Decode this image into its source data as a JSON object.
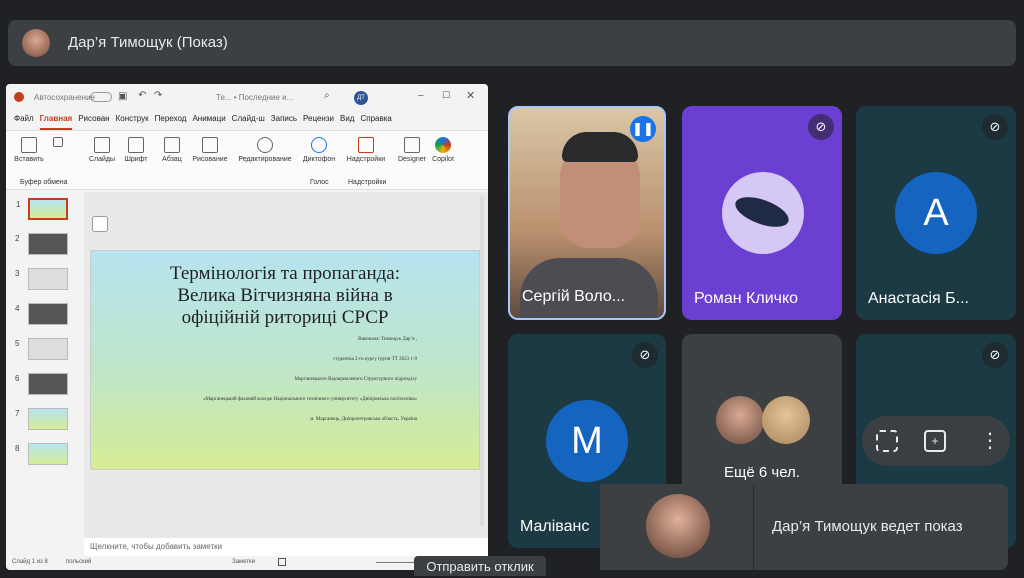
{
  "header": {
    "presenter_title": "Дар’я Тимощук (Показ)"
  },
  "ppt": {
    "titlebar": {
      "autosave": "Автосохранение",
      "doc_title": "Те... • Последние и..."
    },
    "menu": [
      "Файл",
      "Главная",
      "Рисован",
      "Конструк",
      "Переход",
      "Анимаци",
      "Слайд-ш",
      "Запись",
      "Рецензи",
      "Вид",
      "Справка"
    ],
    "active_menu": "Главная",
    "ribbon": {
      "paste": "Вставить",
      "slides": "Слайды",
      "font": "Шрифт",
      "paragraph": "Абзац",
      "drawing": "Рисование",
      "editing": "Редактирование",
      "dictation": "Диктофон",
      "addins": "Надстройки",
      "designer": "Designer",
      "copilot": "Copilot",
      "group_clipboard": "Буфер обмена",
      "group_voice": "Голос",
      "group_addins": "Надстройки"
    },
    "thumb_numbers": [
      "1",
      "2",
      "3",
      "4",
      "5",
      "6",
      "7",
      "8"
    ],
    "slide": {
      "title_line1": "Термінологія та пропаганда:",
      "title_line2": "Велика Вітчизняна війна в",
      "title_line3": "офіційній риториці СРСР",
      "info1": "Виконала: Тимощук Дар’я ,",
      "info2": "студентка 2-го курсу групи ТТ 2023 1-9",
      "info3": "Марганецького Відокремленого Структурного підрозділу",
      "info4": "«Марганецький фаховий коледж Національного технічного університету «Дніпровська політехніка»",
      "info5": "м. Марганець, Дніпропетровська область, Україна"
    },
    "notes_placeholder": "Щелкните, чтобы добавить заметки",
    "status": {
      "slide_count": "Слайд 1 из 8",
      "language": "польский",
      "notes": "Заметки"
    }
  },
  "participants": [
    {
      "name": "Сергій Воло...",
      "state": "speaking"
    },
    {
      "name": "Роман Кличко",
      "state": "muted"
    },
    {
      "name": "Анастасія Б...",
      "initial": "А",
      "state": "muted"
    },
    {
      "name": "Маліванс",
      "initial": "М",
      "state": "muted"
    },
    {
      "name": "Ещё 6 чел."
    },
    {
      "name": "",
      "state": "muted"
    }
  ],
  "presenting_banner": "Дар’я Тимощук ведет показ",
  "feedback_label": "Отправить отклик",
  "colors": {
    "bg": "#202124",
    "panel": "#3c4043",
    "purple": "#6b3fd1",
    "teal": "#1b3a44",
    "blue_avatar": "#1a73e8",
    "ppt_red": "#c43e1c"
  }
}
